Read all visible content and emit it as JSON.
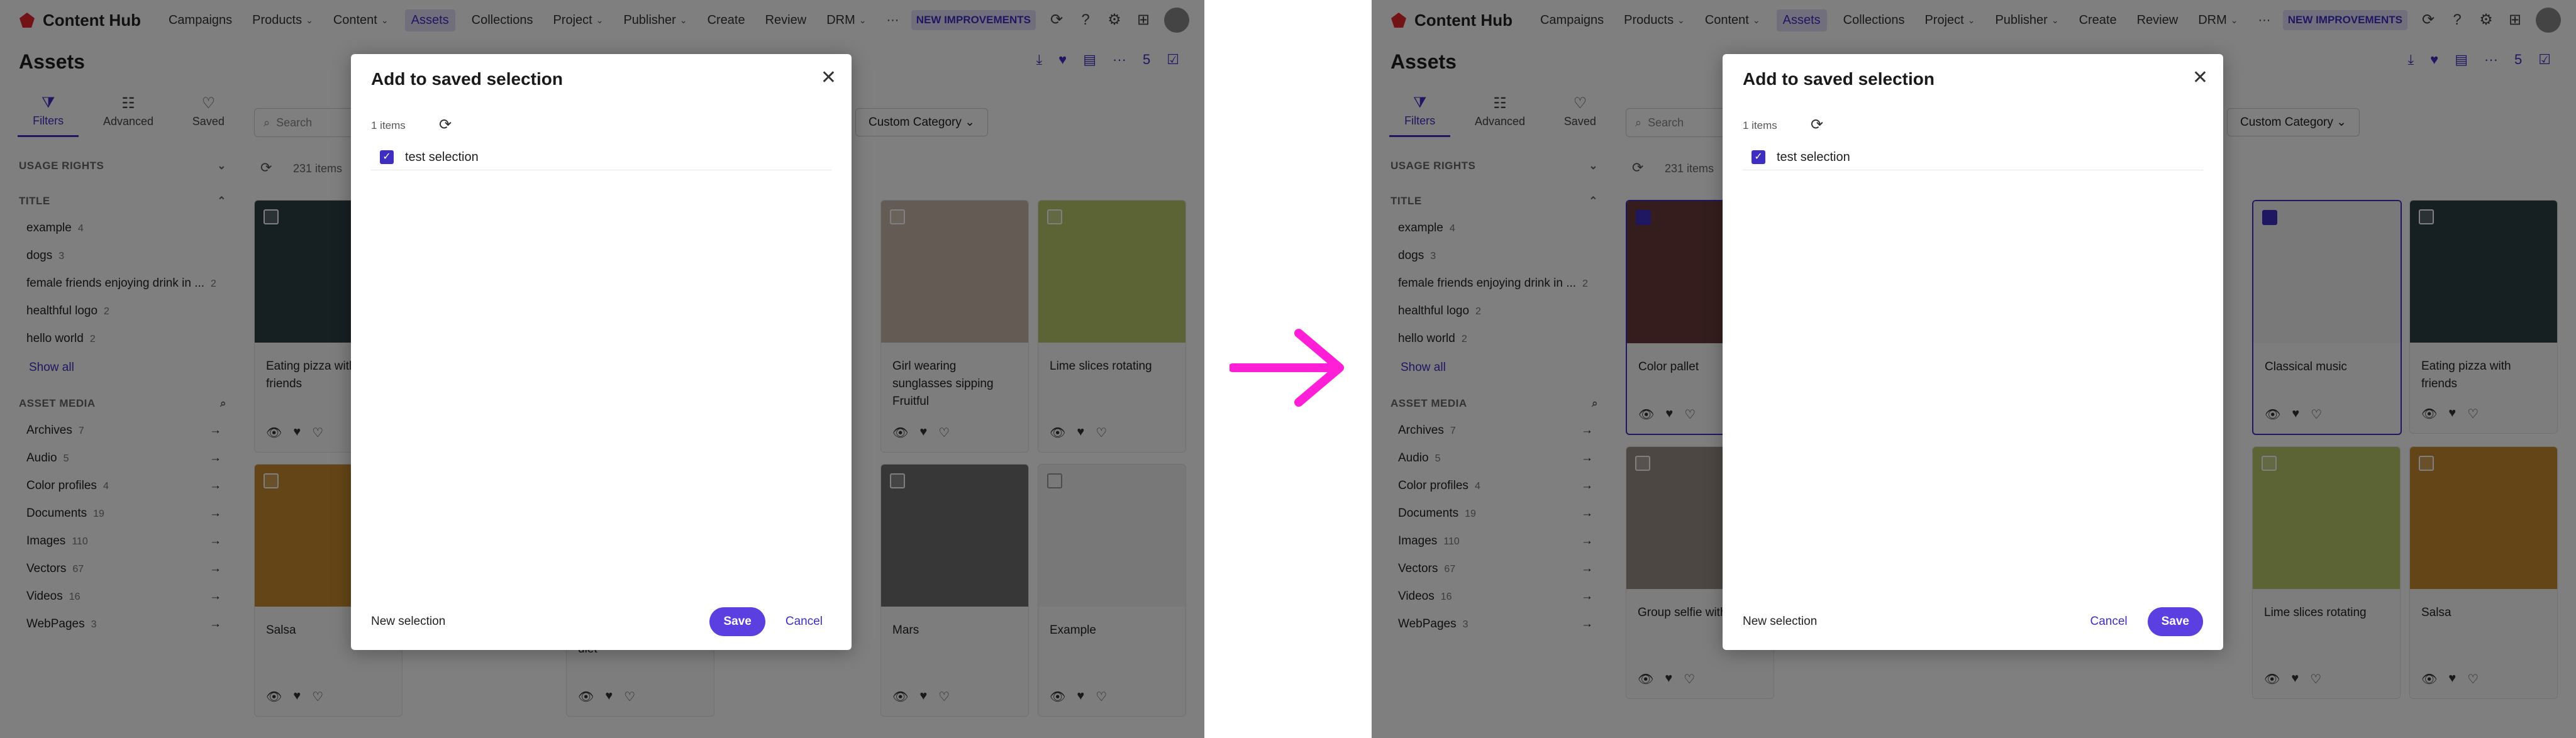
{
  "nav": {
    "brand": "Content Hub",
    "items": [
      "Campaigns",
      "Products",
      "Content",
      "Assets",
      "Collections",
      "Project",
      "Publisher",
      "Create",
      "Review",
      "DRM"
    ],
    "dropdown_items": [
      "Products",
      "Content",
      "Project",
      "Publisher",
      "DRM"
    ],
    "active": "Assets",
    "more": "···",
    "badge": "NEW IMPROVEMENTS"
  },
  "page": {
    "title": "Assets",
    "selected_count": "5"
  },
  "sidebar": {
    "tabs": [
      {
        "label": "Filters",
        "icon": "filter-icon"
      },
      {
        "label": "Advanced",
        "icon": "sliders-icon"
      },
      {
        "label": "Saved",
        "icon": "heart-icon"
      }
    ],
    "usage_rights": "USAGE RIGHTS",
    "title_section": "TITLE",
    "title_items": [
      {
        "label": "example",
        "count": "4"
      },
      {
        "label": "dogs",
        "count": "3"
      },
      {
        "label": "female friends enjoying drink in ...",
        "count": "2"
      },
      {
        "label": "healthful logo",
        "count": "2"
      },
      {
        "label": "hello world",
        "count": "2"
      }
    ],
    "show_all": "Show all",
    "asset_media": "ASSET MEDIA",
    "media_items": [
      {
        "label": "Archives",
        "count": "7"
      },
      {
        "label": "Audio",
        "count": "5"
      },
      {
        "label": "Color profiles",
        "count": "4"
      },
      {
        "label": "Documents",
        "count": "19"
      },
      {
        "label": "Images",
        "count": "110"
      },
      {
        "label": "Vectors",
        "count": "67"
      },
      {
        "label": "Videos",
        "count": "16"
      },
      {
        "label": "WebPages",
        "count": "3"
      }
    ]
  },
  "toolbar": {
    "search_placeholder": "Search",
    "custom_category": "Custom Category",
    "items_count": "231 items"
  },
  "left_cards": [
    {
      "caption": "Eating pizza with friends",
      "color": "#2c3e45"
    },
    {
      "caption": "Girl wearing sunglasses sipping Fruitful",
      "color": "#c9b8a8"
    },
    {
      "caption": "Lime slices rotating",
      "color": "#b8c96a"
    },
    {
      "caption": "Salsa",
      "color": "#c98a2e"
    },
    {
      "caption": "diet",
      "color": "#cccccc"
    },
    {
      "caption": "Mars",
      "color": "#6f6f6f"
    },
    {
      "caption": "Example",
      "color": "#f0f0f0"
    }
  ],
  "right_cards": [
    {
      "caption": "Color pallet",
      "color": "#6b3b3b"
    },
    {
      "caption": "Classical music",
      "color": "#f2f2f2"
    },
    {
      "caption": "Eating pizza with friends",
      "color": "#2c3e45"
    },
    {
      "caption": "Group selfie with drinks",
      "color": "#9a8f86"
    },
    {
      "caption": "Lime slices rotating",
      "color": "#b8c96a"
    },
    {
      "caption": "Salsa",
      "color": "#c98a2e"
    }
  ],
  "modal": {
    "title": "Add to saved selection",
    "count": "1 items",
    "selection_name": "test selection",
    "new_selection": "New selection",
    "save": "Save",
    "cancel": "Cancel"
  },
  "colors": {
    "accent": "#5b3fe0",
    "arrow": "#ff1fd6"
  }
}
